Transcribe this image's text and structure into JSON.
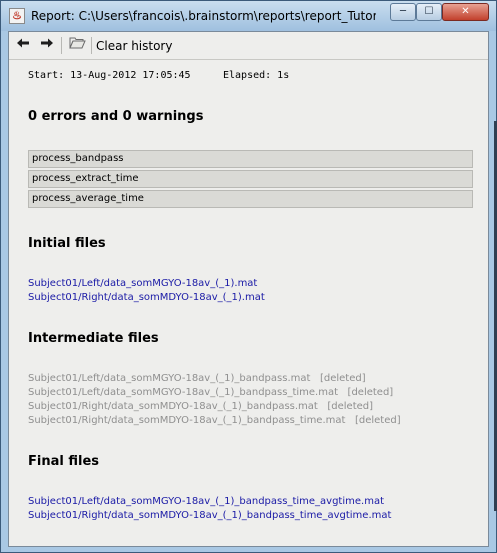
{
  "window": {
    "title": "Report: C:\\Users\\francois\\.brainstorm\\reports\\report_TutorialCTF_",
    "icon": "java-cup-icon",
    "minimize_label": "─",
    "maximize_label": "☐",
    "close_label": "✕"
  },
  "toolbar": {
    "back_icon": "arrow-left-icon",
    "forward_icon": "arrow-right-icon",
    "folder_icon": "folder-open-icon",
    "clear_label": "Clear history"
  },
  "report": {
    "start": "Start: 13-Aug-2012 17:05:45",
    "elapsed": "Elapsed: 1s",
    "summary": "0 errors and 0 warnings",
    "processes": [
      "process_bandpass",
      "process_extract_time",
      "process_average_time"
    ],
    "initial_heading": "Initial files",
    "initial_files": [
      "Subject01/Left/data_somMGYO-18av_(_1).mat",
      "Subject01/Right/data_somMDYO-18av_(_1).mat"
    ],
    "intermediate_heading": "Intermediate files",
    "intermediate_files": [
      "Subject01/Left/data_somMGYO-18av_(_1)_bandpass.mat   [deleted]",
      "Subject01/Left/data_somMGYO-18av_(_1)_bandpass_time.mat   [deleted]",
      "Subject01/Right/data_somMDYO-18av_(_1)_bandpass.mat   [deleted]",
      "Subject01/Right/data_somMDYO-18av_(_1)_bandpass_time.mat   [deleted]"
    ],
    "final_heading": "Final files",
    "final_files": [
      "Subject01/Left/data_somMGYO-18av_(_1)_bandpass_time_avgtime.mat",
      "Subject01/Right/data_somMDYO-18av_(_1)_bandpass_time_avgtime.mat"
    ]
  },
  "colors": {
    "link": "#1a1aa6",
    "deleted": "#8f8f8f",
    "table_row": "#dadad6",
    "background": "#eeeeec",
    "title_bar": "#a9c8e4"
  }
}
